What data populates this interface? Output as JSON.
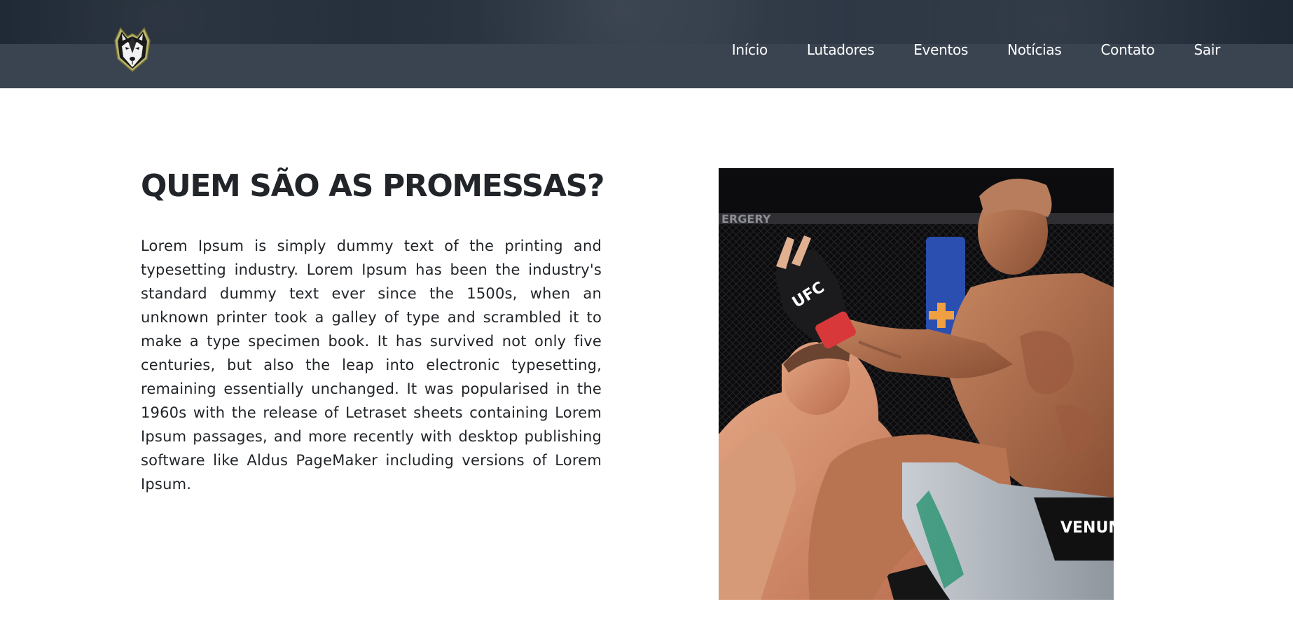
{
  "header": {
    "logo_icon": "wolf-logo-icon",
    "nav": [
      {
        "label": "Início"
      },
      {
        "label": "Lutadores"
      },
      {
        "label": "Eventos"
      },
      {
        "label": "Notícias"
      },
      {
        "label": "Contato"
      },
      {
        "label": "Sair"
      }
    ]
  },
  "main": {
    "title": "QUEM SÃO AS PROMESSAS?",
    "paragraph": "Lorem Ipsum is simply dummy text of the printing and typesetting industry. Lorem Ipsum has been the industry's standard dummy text ever since the 1500s, when an unknown printer took a galley of type and scrambled it to make a type specimen book. It has survived not only five centuries, but also the leap into electronic typesetting, remaining essentially unchanged. It was popularised in the 1960s with the release of Letraset sheets containing Lorem Ipsum passages, and more recently with desktop publishing software like Aldus PageMaker including versions of Lorem Ipsum.",
    "photo": {
      "glove_text": "UFC",
      "shorts_text": "VENUM",
      "banner_text": "ERGERY"
    }
  },
  "colors": {
    "header_bg": "#3a4350",
    "header_top": "#27313e",
    "nav_text": "#ffffff",
    "title": "#212529",
    "body_text": "#212529",
    "page_bg": "#ffffff"
  }
}
